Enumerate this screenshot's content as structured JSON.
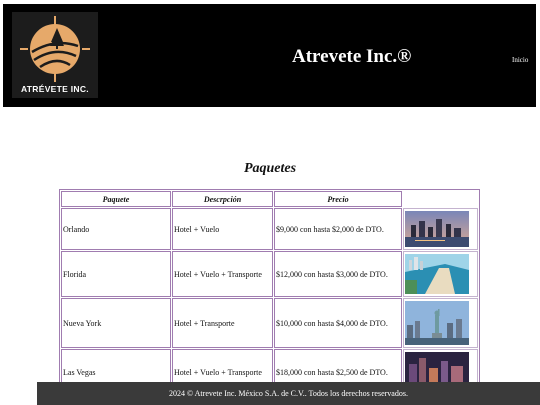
{
  "header": {
    "logo_text": "ATRÉVETE INC.",
    "title": "Atrevete Inc.®",
    "nav": {
      "home": "Inicio"
    }
  },
  "main": {
    "section_title": "Paquetes",
    "columns": [
      "Paquete",
      "Descrpción",
      "Precio"
    ],
    "rows": [
      {
        "package": "Orlando",
        "description": "Hotel + Vuelo",
        "price": "$9,000 con hasta $2,000 de DTO.",
        "image": "orlando-city-photo"
      },
      {
        "package": "Florida",
        "description": "Hotel + Vuelo + Transporte",
        "price": "$12,000 con hasta $3,000 de DTO.",
        "image": "florida-beach-photo"
      },
      {
        "package": "Nueva York",
        "description": "Hotel + Transporte",
        "price": "$10,000 con hasta $4,000 de DTO.",
        "image": "new-york-statue-of-liberty-photo"
      },
      {
        "package": "Las Vegas",
        "description": "Hotel + Vuelo + Transporte",
        "price": "$18,000 con hasta $2,500 de DTO.",
        "image": "las-vegas-night-photo"
      }
    ]
  },
  "footer": {
    "text": "2024 © Atrevete Inc. México S.A. de C.V.. Todos los derechos reservados."
  },
  "colors": {
    "header_bg": "#000000",
    "logo_accent": "#e6a96a",
    "table_border": "#a07cb0",
    "footer_bg": "#3a3a3a"
  }
}
